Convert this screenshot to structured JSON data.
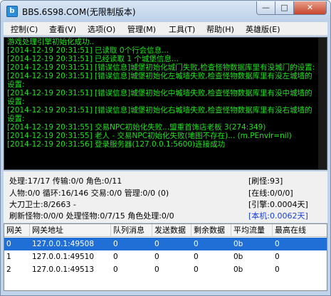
{
  "window": {
    "title": "BBS.6S98.COM(无限制版本)",
    "icon_letter": "b",
    "min_glyph": "—",
    "max_glyph": "□",
    "close_glyph": "✕"
  },
  "menu": [
    "控制(C)",
    "查看(V)",
    "选项(O)",
    "管理(M)",
    "工具(T)",
    "帮助(H)",
    "英雄版(E)"
  ],
  "console": {
    "lines": [
      "游戏处理引擎初始化成功..",
      "[2014-12-19 20:31:51] 已读取 0个行会信息...",
      "[2014-12-19 20:31:51] 已经读取 1 个城堡信息...",
      "[2014-12-19 20:31:51] [错误信息]城堡初始化城门失败,检查怪物数据库里有没城门的设置:",
      "[2014-12-19 20:31:51] [错误信息]城堡初始化左城墙失败,检查怪物数据库里有没左城墙的设置:",
      "[2014-12-19 20:31:51] [错误信息]城堡初始化中城墙失败,检查怪物数据库里有没中城墙的设置:",
      "[2014-12-19 20:31:51] [错误信息]城堡初始化右城墙失败,检查怪物数据库里有没右城墙的设置:",
      "[2014-12-19 20:31:55] 交易NPC初始化失败...盟重首饰店老板 3(274:349)",
      "[2014-12-19 20:31:55] 老人 - 交易NPC初始化失败(地图不存在)... (m.PEnvir=nil)",
      "[2014-12-19 20:31:56] 登录服务器(127.0.0.1:5600)连接成功"
    ]
  },
  "status": {
    "row1_left": "处理:17/17 传输:0/0 角色:0/11",
    "row1_right": "[刷怪:93]",
    "row2_left": "人物:0/0 循环:16/146 交易:0/0 管理:0/0 (0)",
    "row2_right": "[在线:0/0/0]",
    "row3_left": "大刀卫士:8/2663 -",
    "row3_right": "[引擎:0.0004天]",
    "row4_left": "刷新怪物:0/0/0 处理怪物:0/7/15 角色处理:0/0",
    "row4_right": "[本机:0.0062天]",
    "highlight_color": "#1b3fd6"
  },
  "table": {
    "columns": [
      "网关",
      "网关地址",
      "队列消息",
      "发送数据",
      "剩余数据",
      "平均流量",
      "最高在线"
    ],
    "rows": [
      [
        "0",
        "127.0.0.1:49508",
        "0",
        "0",
        "0",
        "0b",
        "0"
      ],
      [
        "1",
        "127.0.0.1:49510",
        "0",
        "0",
        "0",
        "0b",
        "0"
      ],
      [
        "2",
        "127.0.0.1:49513",
        "0",
        "0",
        "0",
        "0b",
        "0"
      ]
    ],
    "selected_row": 0,
    "selection_color": "#1f6fd6"
  }
}
